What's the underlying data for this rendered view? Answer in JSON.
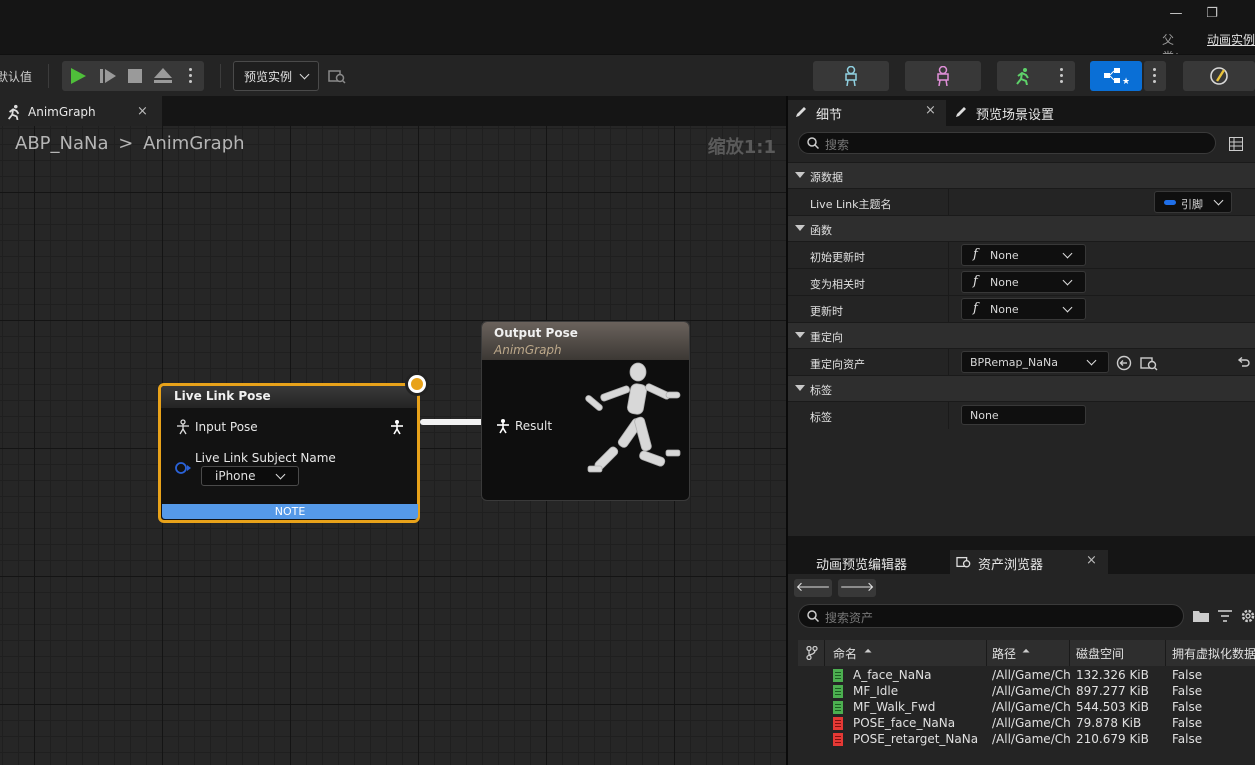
{
  "titlebar": {
    "minimize_glyph": "—",
    "restore_glyph": "❐",
    "parent_label": "父类：",
    "parent_value": "动画实例"
  },
  "toolbar": {
    "defaults_label": "默认值",
    "preview_instance_label": "预览实例"
  },
  "graph_tab": {
    "label": "AnimGraph",
    "close_glyph": "×"
  },
  "graph": {
    "breadcrumb_root": "ABP_NaNa",
    "breadcrumb_sep": ">",
    "breadcrumb_current": "AnimGraph",
    "zoom_label": "缩放1:1",
    "live_link_node": {
      "title": "Live Link Pose",
      "input_pose_label": "Input Pose",
      "subject_name_label": "Live Link Subject Name",
      "subject_value": "iPhone",
      "note_label": "NOTE"
    },
    "output_node": {
      "title": "Output Pose",
      "subtitle": "AnimGraph",
      "result_label": "Result"
    }
  },
  "details_panel": {
    "tab_details": "细节",
    "tab_preview_scene": "预览场景设置",
    "close_glyph": "×",
    "search_placeholder": "搜索",
    "sections": {
      "source_data": "源数据",
      "functions": "函数",
      "retarget": "重定向",
      "tags": "标签"
    },
    "rows": {
      "live_link_subject_label": "Live Link主题名",
      "live_link_subject_value": "引脚",
      "on_initial_update_label": "初始更新时",
      "on_initial_update_value": "None",
      "on_become_relevant_label": "变为相关时",
      "on_become_relevant_value": "None",
      "on_update_label": "更新时",
      "on_update_value": "None",
      "retarget_asset_label": "重定向资产",
      "retarget_asset_value": "BPRemap_NaNa",
      "tag_label": "标签",
      "tag_value": "None"
    }
  },
  "asset_browser": {
    "tab_anim_preview": "动画预览编辑器",
    "tab_asset_browser": "资产浏览器",
    "close_glyph": "×",
    "back_glyph": "🡐",
    "forward_glyph": "🡒",
    "search_placeholder": "搜索资产",
    "columns": [
      "命名",
      "路径",
      "磁盘空间",
      "拥有虚拟化数据"
    ],
    "rows": [
      {
        "name": "A_face_NaNa",
        "path": "/All/Game/Ch",
        "size": "132.326 KiB",
        "virtualized": "False",
        "color": "#4caf50"
      },
      {
        "name": "MF_Idle",
        "path": "/All/Game/Ch",
        "size": "897.277 KiB",
        "virtualized": "False",
        "color": "#4caf50"
      },
      {
        "name": "MF_Walk_Fwd",
        "path": "/All/Game/Ch",
        "size": "544.503 KiB",
        "virtualized": "False",
        "color": "#4caf50"
      },
      {
        "name": "POSE_face_NaNa",
        "path": "/All/Game/Ch",
        "size": "79.878 KiB",
        "virtualized": "False",
        "color": "#e53935"
      },
      {
        "name": "POSE_retarget_NaNa",
        "path": "/All/Game/Ch",
        "size": "210.679 KiB",
        "virtualized": "False",
        "color": "#e53935"
      }
    ]
  },
  "colors": {
    "accent_blue": "#0a6fd6",
    "selection_orange": "#e8a21a",
    "annotation_arrow": "#e0451f",
    "play_green": "#4fbf3a"
  }
}
